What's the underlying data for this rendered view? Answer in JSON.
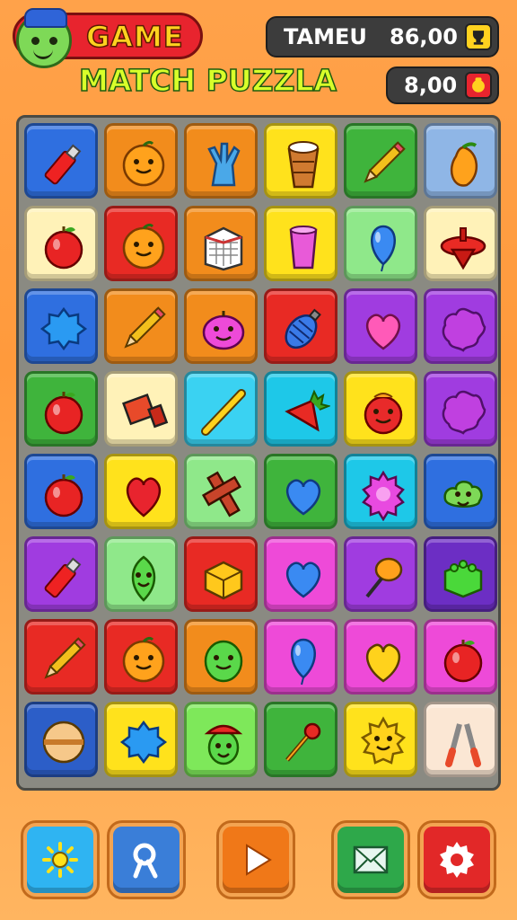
{
  "header": {
    "logo_line1": "GAME",
    "logo_line2": "MATCH PUZZLA"
  },
  "hud": {
    "top_label": "TAMEU",
    "top_value": "86,00",
    "bottom_value": "8,00"
  },
  "colors": {
    "blue": "#2f6fe0",
    "orange": "#f28c1c",
    "yellow": "#ffe21c",
    "green": "#3fb43c",
    "lightblue": "#8fb6e6",
    "cream": "#fff2b8",
    "red": "#e82a24",
    "lightgreen": "#8fe88a",
    "purple": "#a03ce0",
    "cyan": "#3ad2f2",
    "magenta": "#ee4ad8",
    "teal": "#1ec8e8",
    "darkpurple": "#6c2ec4",
    "lime": "#7ee85a",
    "darkblue": "#2c5ec8",
    "beige": "#fbe7d4"
  },
  "board": {
    "rows": [
      [
        {
          "bg": "blue",
          "icon": "red-bottle-icon"
        },
        {
          "bg": "orange",
          "icon": "orange-smiley-icon"
        },
        {
          "bg": "orange",
          "icon": "blue-glove-icon"
        },
        {
          "bg": "yellow",
          "icon": "drink-cup-icon"
        },
        {
          "bg": "green",
          "icon": "pencil-icon"
        },
        {
          "bg": "lightblue",
          "icon": "mango-icon"
        }
      ],
      [
        {
          "bg": "cream",
          "icon": "red-apple-icon"
        },
        {
          "bg": "red",
          "icon": "orange-smiley-icon"
        },
        {
          "bg": "orange",
          "icon": "calendar-box-icon"
        },
        {
          "bg": "yellow",
          "icon": "pink-cup-icon"
        },
        {
          "bg": "lightgreen",
          "icon": "blue-balloon-icon"
        },
        {
          "bg": "cream",
          "icon": "red-spinning-top-icon"
        }
      ],
      [
        {
          "bg": "blue",
          "icon": "blue-gear-blob-icon"
        },
        {
          "bg": "orange",
          "icon": "pencil-icon"
        },
        {
          "bg": "orange",
          "icon": "pink-apple-smiley-icon"
        },
        {
          "bg": "red",
          "icon": "blue-lantern-icon"
        },
        {
          "bg": "purple",
          "icon": "pink-heart-icon"
        },
        {
          "bg": "purple",
          "icon": "purple-splat-icon"
        }
      ],
      [
        {
          "bg": "green",
          "icon": "red-apple-icon"
        },
        {
          "bg": "cream",
          "icon": "red-box-icon"
        },
        {
          "bg": "cyan",
          "icon": "yellow-stick-icon"
        },
        {
          "bg": "teal",
          "icon": "strawberry-icon"
        },
        {
          "bg": "yellow",
          "icon": "red-apple-smiley-icon"
        },
        {
          "bg": "purple",
          "icon": "purple-splat-icon"
        }
      ],
      [
        {
          "bg": "blue",
          "icon": "red-apple-icon"
        },
        {
          "bg": "yellow",
          "icon": "red-heart-icon"
        },
        {
          "bg": "lightgreen",
          "icon": "red-cross-icon"
        },
        {
          "bg": "green",
          "icon": "blue-heart-icon"
        },
        {
          "bg": "teal",
          "icon": "pink-gear-icon"
        },
        {
          "bg": "blue",
          "icon": "green-blob-smiley-icon"
        }
      ],
      [
        {
          "bg": "purple",
          "icon": "red-bottle-icon"
        },
        {
          "bg": "lightgreen",
          "icon": "green-leaf-smiley-icon"
        },
        {
          "bg": "red",
          "icon": "yellow-box-icon"
        },
        {
          "bg": "magenta",
          "icon": "blue-heart-icon"
        },
        {
          "bg": "purple",
          "icon": "orange-pin-icon"
        },
        {
          "bg": "darkpurple",
          "icon": "green-block-icon"
        }
      ],
      [
        {
          "bg": "red",
          "icon": "pencil-icon"
        },
        {
          "bg": "red",
          "icon": "orange-smiley-icon"
        },
        {
          "bg": "orange",
          "icon": "green-smiley-icon"
        },
        {
          "bg": "magenta",
          "icon": "blue-balloon-icon"
        },
        {
          "bg": "magenta",
          "icon": "yellow-heart-icon"
        },
        {
          "bg": "magenta",
          "icon": "red-apple-icon"
        }
      ],
      [
        {
          "bg": "darkblue",
          "icon": "ball-icon"
        },
        {
          "bg": "yellow",
          "icon": "blue-gear-blob-icon"
        },
        {
          "bg": "lime",
          "icon": "green-hat-smiley-icon"
        },
        {
          "bg": "green",
          "icon": "pin-tool-icon"
        },
        {
          "bg": "yellow",
          "icon": "yellow-sun-smiley-icon"
        },
        {
          "bg": "beige",
          "icon": "scissors-icon"
        }
      ]
    ]
  },
  "controls": [
    {
      "name": "settings-sun-button",
      "icon": "sun-icon",
      "bg": "#2fb4f2"
    },
    {
      "name": "hint-button",
      "icon": "magnify-icon",
      "bg": "#3a7ed8"
    },
    {
      "name": "play-button",
      "icon": "play-icon",
      "bg": "#f07818"
    },
    {
      "name": "mail-button",
      "icon": "mail-icon",
      "bg": "#2ea84a"
    },
    {
      "name": "settings-button",
      "icon": "gear-icon",
      "bg": "#e22828"
    }
  ]
}
